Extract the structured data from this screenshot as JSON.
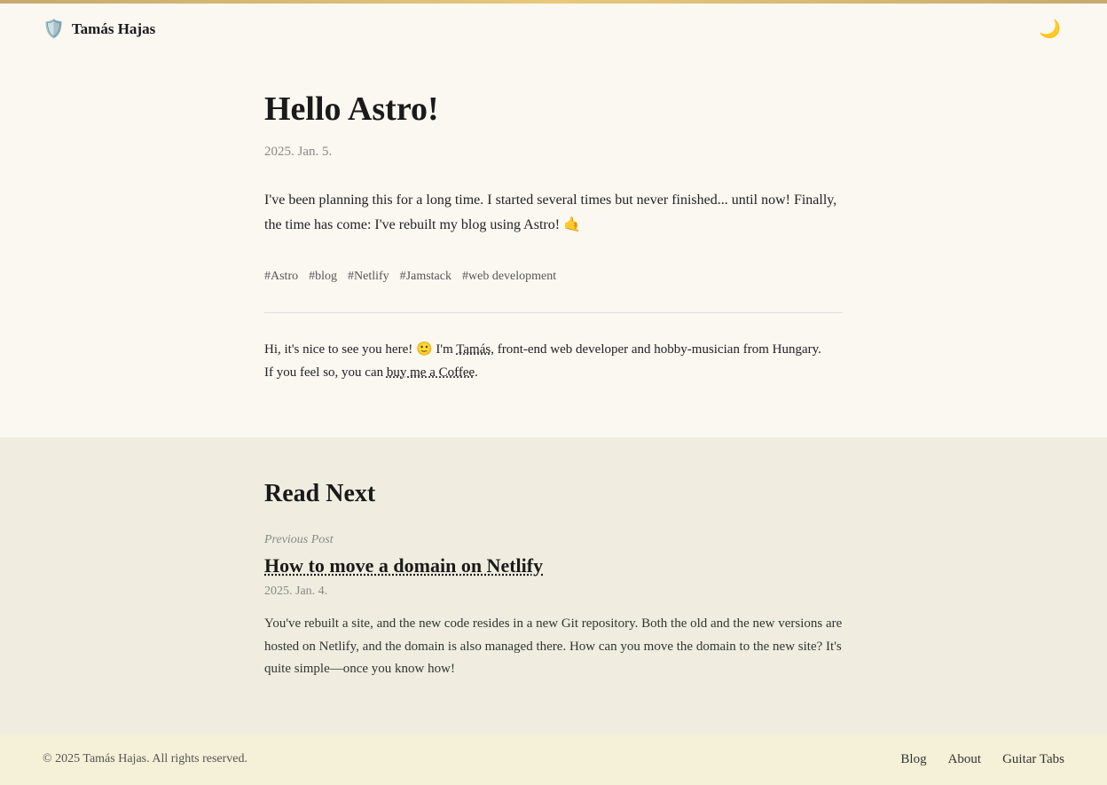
{
  "topBar": {},
  "header": {
    "siteTitle": "Tamás Hajas",
    "siteIcon": "🛡️",
    "darkModeIcon": "🌙"
  },
  "post": {
    "title": "Hello Astro!",
    "date": "2025. Jan. 5.",
    "body1": "I've been planning this for a long time. I started several times but never finished... until now! Finally, the time has come: I've rebuilt my blog using Astro! 🤙",
    "tags": [
      "#Astro",
      "#blog",
      "#Netlify",
      "#Jamstack",
      "#web development"
    ],
    "authorIntro": "Hi, it's nice to see you here! 🙂 I'm ",
    "authorName": "Tamás",
    "authorRest": ", front-end web developer and hobby-musician from Hungary.",
    "authorLine2": "If you feel so, you can ",
    "coffeeLink": "buy me a Coffee",
    "authorEnd": "."
  },
  "readNext": {
    "sectionTitle": "Read Next",
    "previousPostLabel": "Previous Post",
    "prevPostTitle": "How to move a domain on Netlify",
    "prevPostDate": "2025. Jan. 4.",
    "prevPostExcerpt": "You've rebuilt a site, and the new code resides in a new Git repository. Both the old and the new versions are hosted on Netlify, and the domain is also managed there. How can you move the domain to the new site? It's quite simple—once you know how!"
  },
  "footer": {
    "copyright": "© 2025 Tamás Hajas. All rights reserved.",
    "nav": [
      {
        "label": "Blog",
        "id": "blog"
      },
      {
        "label": "About",
        "id": "about"
      },
      {
        "label": "Guitar Tabs",
        "id": "guitar-tabs"
      }
    ]
  }
}
